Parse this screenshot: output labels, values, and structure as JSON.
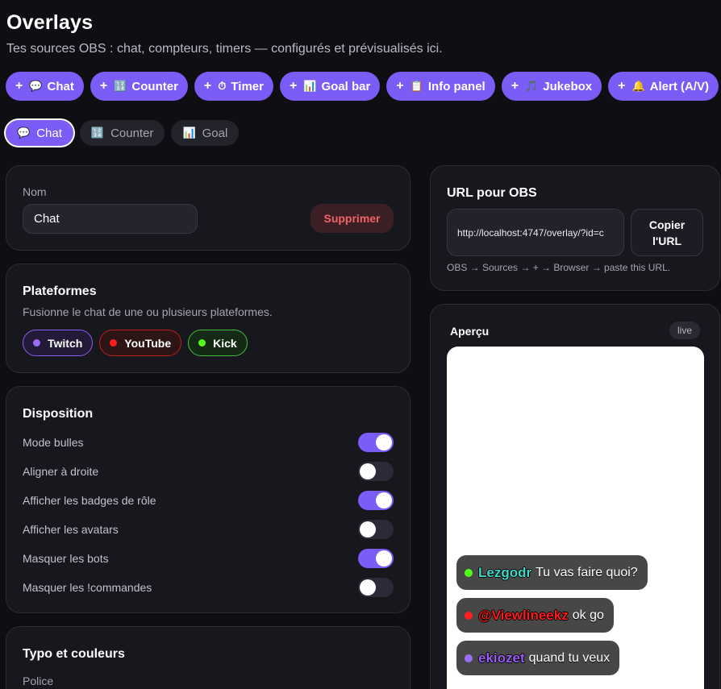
{
  "header": {
    "title": "Overlays",
    "subtitle": "Tes sources OBS : chat, compteurs, timers — configurés et prévisualisés ici."
  },
  "add_buttons": [
    {
      "plus": "+",
      "icon": "💬",
      "label": "Chat"
    },
    {
      "plus": "+",
      "icon": "🔢",
      "label": "Counter"
    },
    {
      "plus": "+",
      "icon": "⏱",
      "label": "Timer"
    },
    {
      "plus": "+",
      "icon": "📊",
      "label": "Goal bar"
    },
    {
      "plus": "+",
      "icon": "📋",
      "label": "Info panel"
    },
    {
      "plus": "+",
      "icon": "🎵",
      "label": "Jukebox"
    },
    {
      "plus": "+",
      "icon": "🔔",
      "label": "Alert (A/V)"
    }
  ],
  "tabs": [
    {
      "icon": "💬",
      "label": "Chat",
      "active": true
    },
    {
      "icon": "🔢",
      "label": "Counter",
      "active": false
    },
    {
      "icon": "📊",
      "label": "Goal",
      "active": false
    }
  ],
  "name_card": {
    "label": "Nom",
    "value": "Chat",
    "delete_label": "Supprimer"
  },
  "platforms_card": {
    "title": "Plateformes",
    "description": "Fusionne le chat de une ou plusieurs plateformes.",
    "platforms": [
      {
        "label": "Twitch",
        "color": "#9b6cf8"
      },
      {
        "label": "YouTube",
        "color": "#ff1f1f"
      },
      {
        "label": "Kick",
        "color": "#53fc18"
      }
    ]
  },
  "layout_card": {
    "title": "Disposition",
    "toggles": [
      {
        "label": "Mode bulles",
        "on": true
      },
      {
        "label": "Aligner à droite",
        "on": false
      },
      {
        "label": "Afficher les badges de rôle",
        "on": true
      },
      {
        "label": "Afficher les avatars",
        "on": false
      },
      {
        "label": "Masquer les bots",
        "on": true
      },
      {
        "label": "Masquer les !commandes",
        "on": false
      }
    ]
  },
  "typo_card": {
    "title": "Typo et couleurs",
    "font_label": "Police"
  },
  "url_card": {
    "title": "URL pour OBS",
    "url": "http://localhost:4747/overlay/?id=c",
    "copy_line1": "Copier",
    "copy_line2": "l'URL",
    "hint": "OBS → Sources → + → Browser → paste this URL."
  },
  "preview_card": {
    "title": "Aperçu",
    "badge": "live",
    "messages": [
      {
        "user": "Lezgodr",
        "text": "Tu vas faire quoi?",
        "color": "#3fd9c9",
        "dot": "#53fc18"
      },
      {
        "user": "@Viewlineekz",
        "text": "ok go",
        "color": "#ff1a1a",
        "dot": "#ff1f1f"
      },
      {
        "user": "ekiozet",
        "text": "quand tu veux",
        "color": "#9b5cf6",
        "dot": "#9b6cf8"
      }
    ]
  },
  "colors": {
    "accent": "#7c5cf6",
    "background": "#0e0e13",
    "card": "#17171e",
    "danger": "#f06464"
  }
}
